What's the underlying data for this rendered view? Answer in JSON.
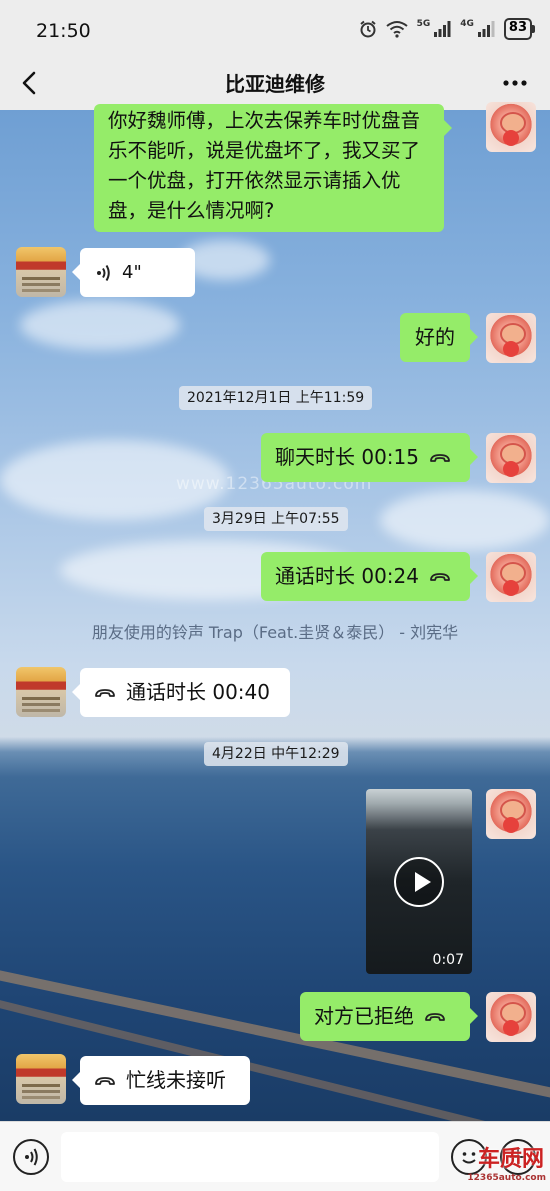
{
  "status_bar": {
    "time": "21:50",
    "network_5g": "5G",
    "network_4g": "4G",
    "battery": "83",
    "icons": [
      "alarm-icon",
      "wifi-icon",
      "signal-icon",
      "signal-icon",
      "battery-icon"
    ]
  },
  "nav": {
    "title": "比亚迪维修",
    "back_icon": "back-arrow-icon",
    "more_icon": "more-icon"
  },
  "messages": {
    "m1": "你好魏师傅，上次去保养车时优盘音乐不能听，说是优盘坏了，我又买了一个优盘，打开依然显示请插入优盘，是什么情况啊?",
    "voice_duration": "4\"",
    "m2": "好的",
    "ts1": "2021年12月1日 上午11:59",
    "call1": "聊天时长 00:15",
    "ts2": "3月29日 上午07:55",
    "call2": "通话时长 00:24",
    "ringtone": "朋友使用的铃声 Trap（Feat.圭贤＆泰民） - 刘宪华",
    "call3": "通话时长 00:40",
    "ts3": "4月22日 中午12:29",
    "video_duration": "0:07",
    "call4": "对方已拒绝",
    "call5": "忙线未接听"
  },
  "watermark": "www.12365auto.com",
  "logo": {
    "big": "车质网",
    "small": "12365auto.com"
  },
  "colors": {
    "sent_bubble": "#95ec69",
    "received_bubble": "#ffffff",
    "bar_background": "#ededed"
  }
}
